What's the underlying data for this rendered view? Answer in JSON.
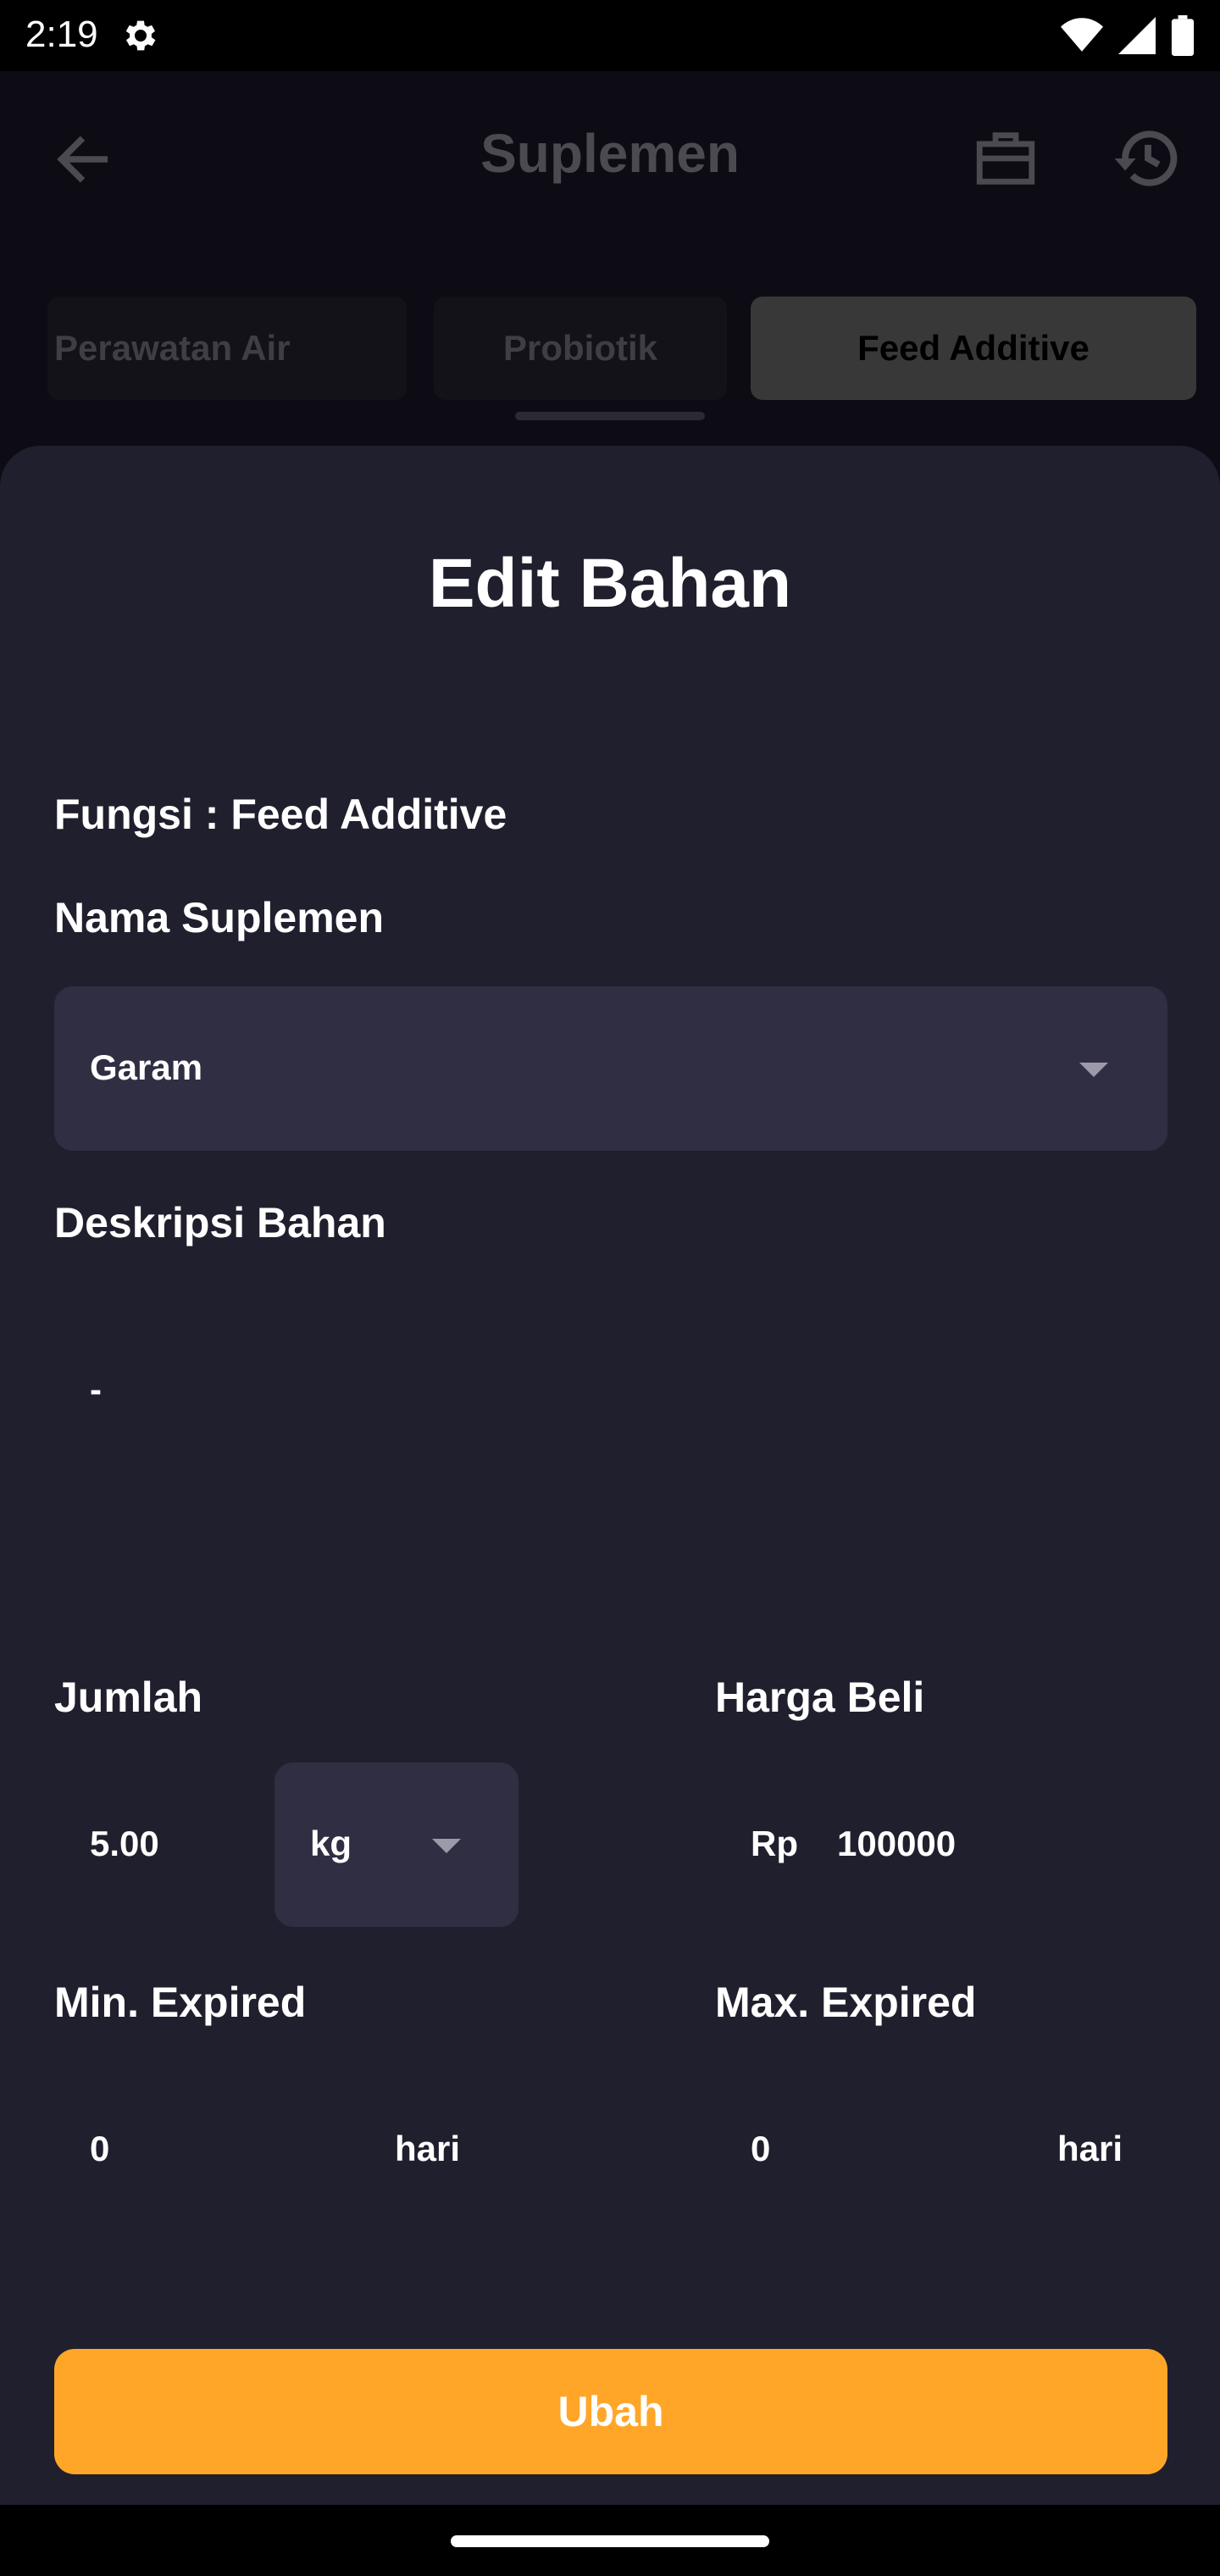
{
  "status_bar": {
    "time": "2:19",
    "icons": [
      "settings-icon",
      "wifi-icon",
      "signal-icon",
      "battery-icon"
    ]
  },
  "app_bar": {
    "title": "Suplemen",
    "icons": [
      "back-arrow-icon",
      "briefcase-icon",
      "history-icon"
    ]
  },
  "tabs": [
    {
      "label": "Perawatan Air",
      "selected": false
    },
    {
      "label": "Probiotik",
      "selected": false
    },
    {
      "label": "Feed Additive",
      "selected": true
    }
  ],
  "sheet": {
    "title": "Edit Bahan",
    "fungsi_label": "Fungsi : ",
    "fungsi_value": "Feed Additive",
    "nama_label": "Nama Suplemen",
    "nama_value": "Garam",
    "deskripsi_label": "Deskripsi Bahan",
    "deskripsi_value": "-",
    "jumlah_label": "Jumlah",
    "jumlah_value": "5.00",
    "unit_value": "kg",
    "harga_label": "Harga Beli",
    "harga_prefix": "Rp",
    "harga_value": "100000",
    "min_label": "Min. Expired",
    "min_value": "0",
    "min_suffix": "hari",
    "max_label": "Max. Expired",
    "max_value": "0",
    "max_suffix": "hari",
    "submit_label": "Ubah"
  },
  "colors": {
    "accent": "#ffa629",
    "sheet_bg": "#201f2d",
    "field_bg": "#302e43"
  }
}
